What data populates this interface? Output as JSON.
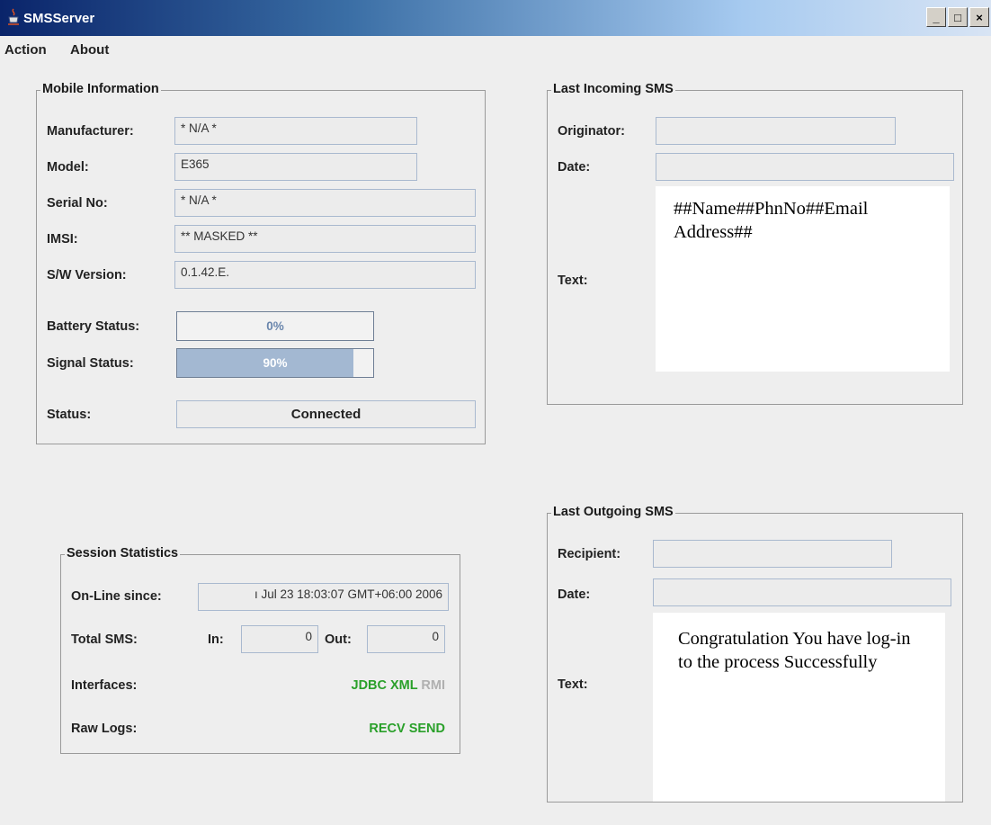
{
  "window": {
    "title": "SMSServer"
  },
  "menu": {
    "items": [
      "Action",
      "About"
    ]
  },
  "mobile_info": {
    "title": "Mobile Information",
    "manufacturer_label": "Manufacturer:",
    "manufacturer": "* N/A *",
    "model_label": "Model:",
    "model": "E365",
    "serial_label": "Serial No:",
    "serial": "* N/A *",
    "imsi_label": "IMSI:",
    "imsi": "** MASKED **",
    "sw_label": "S/W Version:",
    "sw_version": "0.1.42.E.",
    "battery_label": "Battery Status:",
    "battery_text": "0%",
    "battery_value": 0,
    "signal_label": "Signal Status:",
    "signal_text": "90%",
    "signal_value": 90,
    "status_label": "Status:",
    "status": "Connected"
  },
  "incoming": {
    "title": "Last Incoming SMS",
    "originator_label": "Originator:",
    "originator": "",
    "date_label": "Date:",
    "date": "",
    "text_label": "Text:",
    "text": "##Name##PhnNo##Email Address##"
  },
  "session": {
    "title": "Session Statistics",
    "online_label": "On-Line since:",
    "online": "ı Jul 23 18:03:07 GMT+06:00 2006",
    "total_label": "Total SMS:",
    "in_label": "In:",
    "in_value": "0",
    "out_label": "Out:",
    "out_value": "0",
    "interfaces_label": "Interfaces:",
    "jdbc": "JDBC",
    "xml": "XML",
    "rmi": "RMI",
    "rawlogs_label": "Raw Logs:",
    "recv": "RECV",
    "send": "SEND"
  },
  "outgoing": {
    "title": "Last Outgoing SMS",
    "recipient_label": "Recipient:",
    "recipient": "",
    "date_label": "Date:",
    "date": "",
    "text_label": "Text:",
    "text": "Congratulation You have log-in to the process Successfully"
  },
  "colors": {
    "enabled": "#2aa02a",
    "disabled": "#b0b0b0",
    "bar_fill": "#a3b8d2"
  }
}
